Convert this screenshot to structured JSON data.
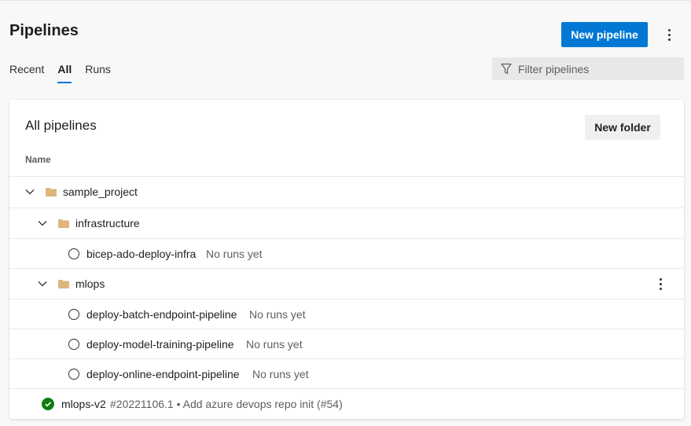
{
  "header": {
    "title": "Pipelines",
    "new_pipeline_label": "New pipeline"
  },
  "tabs": [
    {
      "label": "Recent",
      "active": false
    },
    {
      "label": "All",
      "active": true
    },
    {
      "label": "Runs",
      "active": false
    }
  ],
  "filter": {
    "placeholder": "Filter pipelines",
    "icon": "filter-icon"
  },
  "card": {
    "title": "All pipelines",
    "new_folder_label": "New folder",
    "column_name": "Name"
  },
  "tree": {
    "sample_project": {
      "name": "sample_project",
      "expanded": true
    },
    "infrastructure": {
      "name": "infrastructure",
      "expanded": true
    },
    "bicep": {
      "name": "bicep-ado-deploy-infra",
      "status": "No runs yet"
    },
    "mlops": {
      "name": "mlops",
      "expanded": true
    },
    "batch": {
      "name": "deploy-batch-endpoint-pipeline",
      "status": "No runs yet"
    },
    "training": {
      "name": "deploy-model-training-pipeline",
      "status": "No runs yet"
    },
    "online": {
      "name": "deploy-online-endpoint-pipeline",
      "status": "No runs yet"
    },
    "mlops_v2": {
      "name": "mlops-v2",
      "run_info": "#20221106.1 • Add azure devops repo init (#54)",
      "status": "succeeded"
    }
  },
  "colors": {
    "accent": "#0078d4",
    "success": "#107c10",
    "folder": "#dcb67a"
  }
}
